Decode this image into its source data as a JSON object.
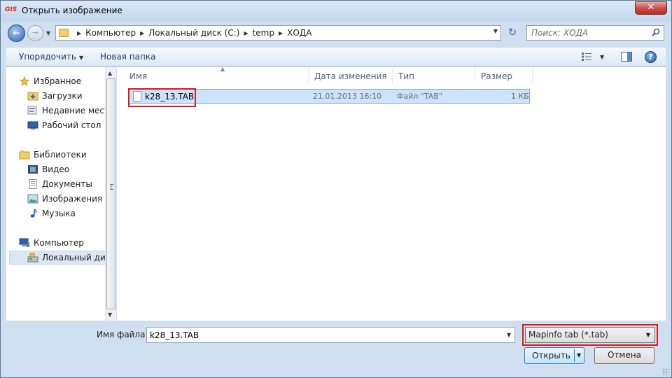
{
  "window": {
    "title": "Открыть изображение",
    "app_badge": "GIS",
    "close_glyph": "✕"
  },
  "address": {
    "crumbs": [
      "Компьютер",
      "Локальный диск (C:)",
      "temp",
      "ХОДА"
    ]
  },
  "search": {
    "placeholder": "Поиск: ХОДА"
  },
  "toolbar": {
    "organize_label": "Упорядочить",
    "new_folder_label": "Новая папка",
    "help_glyph": "?"
  },
  "navpane": {
    "items": [
      {
        "label": "Избранное",
        "icon": "star-icon",
        "kind": "group"
      },
      {
        "label": "Загрузки",
        "icon": "downloads-folder-icon",
        "kind": "child"
      },
      {
        "label": "Недавние места",
        "icon": "recent-places-icon",
        "kind": "child"
      },
      {
        "label": "Рабочий стол",
        "icon": "desktop-icon",
        "kind": "child"
      },
      {
        "label": "Библиотеки",
        "icon": "libraries-icon",
        "kind": "group"
      },
      {
        "label": "Видео",
        "icon": "video-icon",
        "kind": "child"
      },
      {
        "label": "Документы",
        "icon": "documents-icon",
        "kind": "child"
      },
      {
        "label": "Изображения",
        "icon": "pictures-icon",
        "kind": "child"
      },
      {
        "label": "Музыка",
        "icon": "music-icon",
        "kind": "child"
      },
      {
        "label": "Компьютер",
        "icon": "computer-icon",
        "kind": "group"
      },
      {
        "label": "Локальный диск (C:)",
        "icon": "local-disk-icon",
        "kind": "child",
        "selected": true
      }
    ]
  },
  "filelist": {
    "columns": [
      "Имя",
      "Дата изменения",
      "Тип",
      "Размер"
    ],
    "rows": [
      {
        "name": "k28_13.TAB",
        "date": "21.01.2013 16:10",
        "type": "Файл \"TAB\"",
        "size": "1 КБ",
        "selected": true
      }
    ]
  },
  "bottom": {
    "filename_label": "Имя файла:",
    "filename_value": "k28_13.TAB",
    "filter_value": "Mapinfo tab (*.tab)",
    "open_label": "Открыть",
    "cancel_label": "Отмена"
  },
  "colors": {
    "highlight_border": "#e11919",
    "selection_fill": "#cce3fb",
    "window_frame": "#cfdff0"
  }
}
